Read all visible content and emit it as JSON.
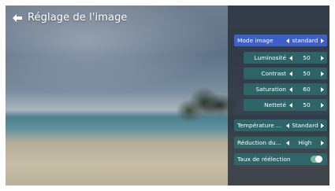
{
  "header": {
    "title": "Réglage de l'image"
  },
  "menu": {
    "picture_mode": {
      "label": "Mode image",
      "value": "standard"
    },
    "brightness": {
      "label": "Luminosité",
      "value": "50"
    },
    "contrast": {
      "label": "Contrast",
      "value": "50"
    },
    "saturation": {
      "label": "Saturation",
      "value": "60"
    },
    "sharpness": {
      "label": "Netteté",
      "value": "50"
    },
    "color_temperature": {
      "label": "Température ...",
      "value": "Standard"
    },
    "noise_reduction": {
      "label": "Réduction du...",
      "value": "High"
    },
    "refresh_rate": {
      "label": "Taux de réélection",
      "toggle_on": true
    }
  },
  "colors": {
    "active_row": "#3d5fc9",
    "row": "#2c7072",
    "panel": "#2a323c",
    "toggle": "#7fb89a"
  }
}
